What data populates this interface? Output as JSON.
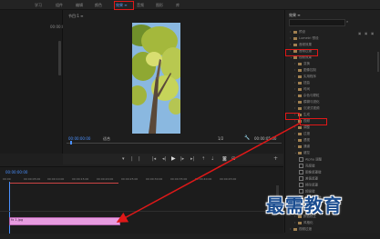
{
  "workspace_tabs": [
    {
      "label": "学习"
    },
    {
      "label": "组件"
    },
    {
      "label": "编辑"
    },
    {
      "label": "颜色"
    },
    {
      "label": "效果 ≡"
    },
    {
      "label": "音频"
    },
    {
      "label": "图形"
    },
    {
      "label": "库"
    }
  ],
  "source_panel": {
    "timecode": "00:00:00"
  },
  "program": {
    "title": "节目:1 ≡",
    "timecode_left": "00:00:00:00",
    "fit_label": "适合",
    "quality": "1/2",
    "timecode_right": "00:00:05:00"
  },
  "timeline": {
    "timecode": "00:00:00:00",
    "ruler_left": "00:00",
    "ruler_labels": [
      "00:00:05:00",
      "00:00:10:00",
      "00:00:15:00",
      "00:00:20:00",
      "00:00:25:00",
      "00:00:30:00",
      "00:00:35:00",
      "00:00:40:00",
      "00:00:45:00"
    ],
    "clip_label": "fx 1.jpg"
  },
  "effects_panel": {
    "title": "效果 ≡",
    "items": [
      {
        "label": "预设",
        "type": "folder",
        "indent": 1,
        "arrow": "›"
      },
      {
        "label": "Lumetri 预设",
        "type": "folder",
        "indent": 1,
        "arrow": "›"
      },
      {
        "label": "音频效果",
        "type": "folder",
        "indent": 1,
        "arrow": "›"
      },
      {
        "label": "音频过渡",
        "type": "folder",
        "indent": 1,
        "arrow": "›"
      },
      {
        "label": "视频效果",
        "type": "folder",
        "indent": 1,
        "arrow": "⌄"
      },
      {
        "label": "变换",
        "type": "folder",
        "indent": 2,
        "arrow": "›"
      },
      {
        "label": "图像控制",
        "type": "folder",
        "indent": 2,
        "arrow": "›"
      },
      {
        "label": "实用程序",
        "type": "folder",
        "indent": 2,
        "arrow": "›"
      },
      {
        "label": "扭曲",
        "type": "folder",
        "indent": 2,
        "arrow": "›"
      },
      {
        "label": "时间",
        "type": "folder",
        "indent": 2,
        "arrow": "›"
      },
      {
        "label": "杂色与颗粒",
        "type": "folder",
        "indent": 2,
        "arrow": "›"
      },
      {
        "label": "模糊与锐化",
        "type": "folder",
        "indent": 2,
        "arrow": "›"
      },
      {
        "label": "沉浸式视频",
        "type": "folder",
        "indent": 2,
        "arrow": "›"
      },
      {
        "label": "生成",
        "type": "folder",
        "indent": 2,
        "arrow": "›"
      },
      {
        "label": "视频",
        "type": "folder",
        "indent": 2,
        "arrow": "›"
      },
      {
        "label": "调整",
        "type": "folder",
        "indent": 2,
        "arrow": "›"
      },
      {
        "label": "过渡",
        "type": "folder",
        "indent": 2,
        "arrow": "›"
      },
      {
        "label": "透视",
        "type": "folder",
        "indent": 2,
        "arrow": "›"
      },
      {
        "label": "通道",
        "type": "folder",
        "indent": 2,
        "arrow": "›"
      },
      {
        "label": "键控",
        "type": "folder",
        "indent": 2,
        "arrow": "⌄"
      },
      {
        "label": "Alpha 调整",
        "type": "effect",
        "indent": 3
      },
      {
        "label": "亮度键",
        "type": "effect",
        "indent": 3
      },
      {
        "label": "图像遮罩键",
        "type": "effect",
        "indent": 3
      },
      {
        "label": "差值遮罩",
        "type": "effect",
        "indent": 3
      },
      {
        "label": "移除遮罩",
        "type": "effect",
        "indent": 3
      },
      {
        "label": "超级键",
        "type": "effect",
        "indent": 3
      },
      {
        "label": "轨道遮罩键",
        "type": "effect",
        "indent": 3
      },
      {
        "label": "非红色键",
        "type": "effect",
        "indent": 3
      },
      {
        "label": "颜色键",
        "type": "effect",
        "indent": 3
      },
      {
        "label": "颜色校正",
        "type": "folder",
        "indent": 2,
        "arrow": "›"
      },
      {
        "label": "风格化",
        "type": "folder",
        "indent": 2,
        "arrow": "›"
      },
      {
        "label": "视频过渡",
        "type": "folder",
        "indent": 1,
        "arrow": "›"
      }
    ]
  },
  "watermark": "最需教育",
  "colors": {
    "accent": "#5aa0ff",
    "highlight": "#e01818",
    "clip": "#e79be0",
    "watermark": "#1b4d90"
  }
}
